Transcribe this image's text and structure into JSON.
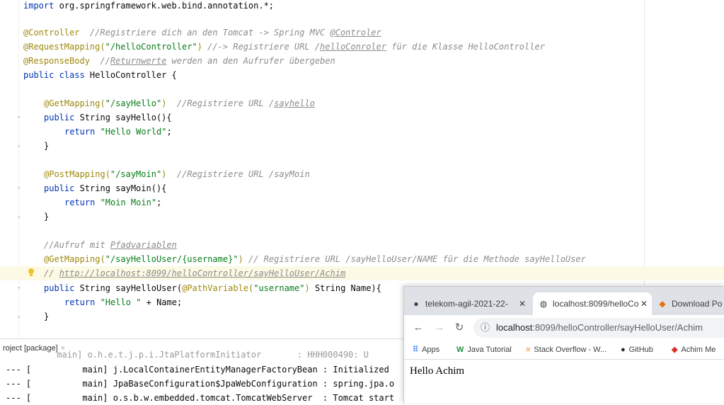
{
  "editor": {
    "lines": {
      "l1": {
        "kw": "import",
        "rest": " org.springframework.web.bind.annotation.*;"
      },
      "l2": {
        "ann": "@Controller",
        "cmt": "  //Registriere dich an den Tomcat -> Spring MVC ",
        "cmt_u": "@Controler"
      },
      "l3": {
        "ann": "@RequestMapping(",
        "str": "\"/helloController\"",
        "ann2": ")",
        "cmt": " //-> Registriere URL /",
        "cmt_u": "helloConroler",
        "cmt2": " für die Klasse HelloController"
      },
      "l4": {
        "ann": "@ResponseBody",
        "cmt": "  //",
        "cmt_u": "Returnwerte",
        "cmt2": " werden an den Aufrufer übergeben"
      },
      "l5": {
        "kw": "public class",
        "rest": " HelloController {"
      },
      "l6": {
        "ann": "@GetMapping(",
        "str": "\"/sayHello\"",
        "ann2": ")",
        "cmt": "  //Registriere URL /",
        "cmt_u": "sayhello"
      },
      "l7": {
        "kw": "public",
        "rest": " String sayHello(){"
      },
      "l8": {
        "kw": "return",
        "str": " \"Hello World\"",
        "rest": ";"
      },
      "l9": {
        "rest": "}"
      },
      "l10": {
        "ann": "@PostMapping(",
        "str": "\"/sayMoin\"",
        "ann2": ")",
        "cmt": "  //Registriere URL /sayMoin"
      },
      "l11": {
        "kw": "public",
        "rest": " String sayMoin(){"
      },
      "l12": {
        "kw": "return",
        "str": " \"Moin Moin\"",
        "rest": ";"
      },
      "l13": {
        "rest": "}"
      },
      "l14": {
        "cmt": "//Aufruf mit ",
        "cmt_u": "Pfadvariablen"
      },
      "l15": {
        "ann": "@GetMapping(",
        "str": "\"/sayHelloUser/{username}\"",
        "ann2": ")",
        "cmt": " // Registriere URL /sayHelloUser/NAME für die Methode sayHelloUser"
      },
      "l16": {
        "cmt": "// ",
        "link": "http://localhost:8099/helloController/sayHelloUser/Achim"
      },
      "l17": {
        "kw": "public",
        "rest": " String sayHelloUser(",
        "ann": "@PathVariable(",
        "str": "\"username\"",
        "ann2": ")",
        "rest2": " String Name){"
      },
      "l18": {
        "kw": "return",
        "str": " \"Hello \"",
        "rest": " + Name;"
      },
      "l19": {
        "rest": "}"
      }
    }
  },
  "console": {
    "tab_label": "roject [package]",
    "lines": [
      {
        "prefix": "",
        "text": "          main] o.h.e.t.j.p.i.JtaPlatformInitiator       : HHH000490: U"
      },
      {
        "prefix": "--- [",
        "text": "          main] j.LocalContainerEntityManagerFactoryBean : Initialized"
      },
      {
        "prefix": "--- [",
        "text": "          main] JpaBaseConfiguration$JpaWebConfiguration : spring.jpa.o"
      },
      {
        "prefix": "--- [",
        "text": "          main] o.s.b.w.embedded.tomcat.TomcatWebServer  : Tomcat start"
      }
    ]
  },
  "browser": {
    "tabs": [
      {
        "label": "telekom-agil-2021-22-",
        "icon": "github-icon"
      },
      {
        "label": "localhost:8099/helloCo",
        "icon": "globe-icon"
      },
      {
        "label": "Download Po",
        "icon": "download-icon"
      }
    ],
    "url_host": "localhost",
    "url_path": ":8099/helloController/sayHelloUser/Achim",
    "bookmarks": [
      "Apps",
      "Java Tutorial",
      "Stack Overflow - W...",
      "GitHub",
      "Achim Me"
    ],
    "page_text": "Hello Achim"
  }
}
